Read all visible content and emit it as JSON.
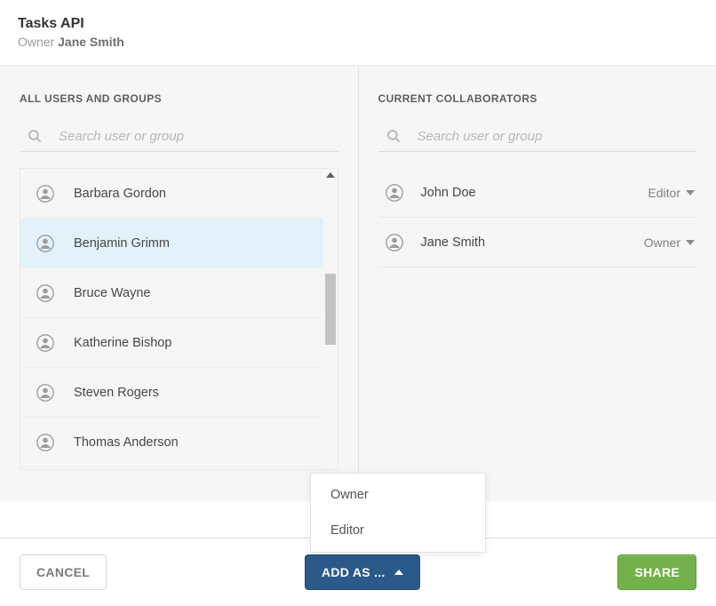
{
  "header": {
    "title": "Tasks API",
    "owner_label": "Owner",
    "owner_name": "Jane Smith"
  },
  "left_panel": {
    "section_title": "ALL USERS AND GROUPS",
    "search_placeholder": "Search user or group",
    "users": [
      {
        "name": "Barbara Gordon",
        "selected": false
      },
      {
        "name": "Benjamin Grimm",
        "selected": true
      },
      {
        "name": "Bruce Wayne",
        "selected": false
      },
      {
        "name": "Katherine Bishop",
        "selected": false
      },
      {
        "name": "Steven Rogers",
        "selected": false
      },
      {
        "name": "Thomas Anderson",
        "selected": false
      }
    ]
  },
  "right_panel": {
    "section_title": "CURRENT COLLABORATORS",
    "search_placeholder": "Search user or group",
    "collaborators": [
      {
        "name": "John Doe",
        "role": "Editor"
      },
      {
        "name": "Jane Smith",
        "role": "Owner"
      }
    ]
  },
  "addas_menu": {
    "options": [
      "Owner",
      "Editor"
    ]
  },
  "footer": {
    "cancel_label": "CANCEL",
    "addas_label": "ADD AS ...",
    "share_label": "SHARE"
  }
}
